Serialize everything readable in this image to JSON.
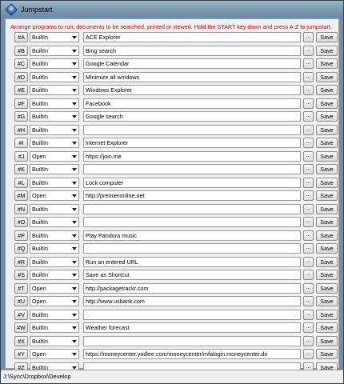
{
  "window": {
    "title": "Jumpstart"
  },
  "instructions": "Arrange programs to run, documents to be searched, printed or viewed. Hold the START key down and press A-Z to jumpstart.",
  "status_path": "J:\\Sync\\Dropbox\\Develop",
  "browse_label": "...",
  "save_label": "Save",
  "rows": [
    {
      "key": "#A",
      "type": "BuiltIn",
      "value": "ACE Explorer"
    },
    {
      "key": "#B",
      "type": "BuiltIn",
      "value": "Bing search"
    },
    {
      "key": "#C",
      "type": "BuiltIn",
      "value": "Google Calendar"
    },
    {
      "key": "#D",
      "type": "BuiltIn",
      "value": "Minimize all windows"
    },
    {
      "key": "#E",
      "type": "BuiltIn",
      "value": "Windows Explorer"
    },
    {
      "key": "#F",
      "type": "BuiltIn",
      "value": "Facebook"
    },
    {
      "key": "#G",
      "type": "BuiltIn",
      "value": "Google search"
    },
    {
      "key": "#H",
      "type": "BuiltIn",
      "value": ""
    },
    {
      "key": "#I",
      "type": "BuiltIn",
      "value": "Internet Explorer"
    },
    {
      "key": "#J",
      "type": "Open",
      "value": "https://join.me"
    },
    {
      "key": "#K",
      "type": "BuiltIn",
      "value": ""
    },
    {
      "key": "#L",
      "type": "BuiltIn",
      "value": "Lock computer"
    },
    {
      "key": "#M",
      "type": "Open",
      "value": "http://premieronline.net"
    },
    {
      "key": "#N",
      "type": "BuiltIn",
      "value": ""
    },
    {
      "key": "#O",
      "type": "BuiltIn",
      "value": ""
    },
    {
      "key": "#P",
      "type": "BuiltIn",
      "value": "Play Pandora music"
    },
    {
      "key": "#Q",
      "type": "BuiltIn",
      "value": ""
    },
    {
      "key": "#R",
      "type": "BuiltIn",
      "value": "Run an entered URL"
    },
    {
      "key": "#S",
      "type": "BuiltIn",
      "value": "Save as Shortcut"
    },
    {
      "key": "#T",
      "type": "Open",
      "value": "http://packagetrackr.com"
    },
    {
      "key": "#U",
      "type": "Open",
      "value": "http://www.usbank.com"
    },
    {
      "key": "#V",
      "type": "BuiltIn",
      "value": ""
    },
    {
      "key": "#W",
      "type": "BuiltIn",
      "value": "Weather forecast"
    },
    {
      "key": "#X",
      "type": "BuiltIn",
      "value": ""
    },
    {
      "key": "#Y",
      "type": "Open",
      "value": "https://moneycenter.yodlee.com/moneycenter/mfalogin.moneycenter.do"
    },
    {
      "key": "#Z",
      "type": "BuiltIn",
      "value": ""
    }
  ]
}
